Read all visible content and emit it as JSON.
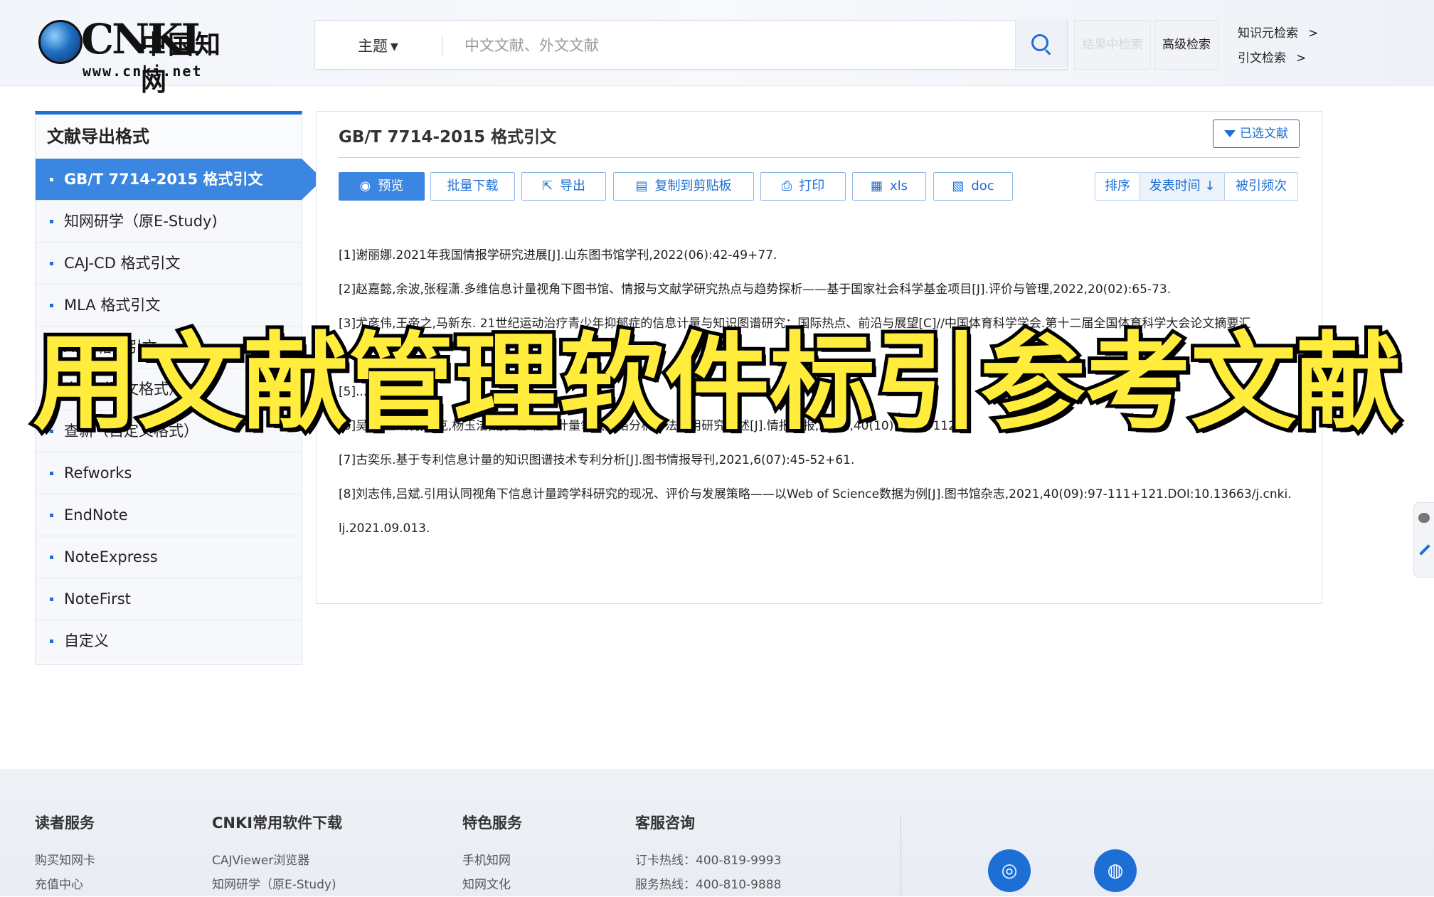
{
  "header": {
    "logo_brand": "CNKI",
    "logo_cn": "中国知网",
    "logo_url": "www.cnki.net",
    "scope_label": "主题",
    "search_placeholder": "中文文献、外文文献",
    "in_result_label": "结果中检索",
    "advanced_label": "高级检索",
    "knowledge_search": "知识元检索",
    "citation_search": "引文检索",
    "arrow": ">"
  },
  "sidebar": {
    "title": "文献导出格式",
    "items": [
      {
        "label": "GB/T 7714-2015 格式引文",
        "active": true
      },
      {
        "label": "知网研学（原E-Study)"
      },
      {
        "label": "CAJ-CD 格式引文"
      },
      {
        "label": "MLA 格式引文"
      },
      {
        "label": "APA 格式引文"
      },
      {
        "label": "查新（引文格式）"
      },
      {
        "label": "查新（自定义格式）"
      },
      {
        "label": "Refworks"
      },
      {
        "label": "EndNote"
      },
      {
        "label": "NoteExpress"
      },
      {
        "label": "NoteFirst"
      },
      {
        "label": "自定义"
      }
    ]
  },
  "panel": {
    "title": "GB/T 7714-2015 格式引文",
    "selected_label": "已选文献",
    "toolbar": {
      "preview": "预览",
      "batch_download": "批量下载",
      "export": "导出",
      "copy_clipboard": "复制到剪贴板",
      "print": "打印",
      "xls": "xls",
      "doc": "doc"
    },
    "sort": {
      "label": "排序",
      "by_date": "发表时间",
      "by_citations": "被引频次"
    },
    "references": [
      "[1]谢丽娜.2021年我国情报学研究进展[J].山东图书馆学刊,2022(06):42-49+77.",
      "[2]赵嘉懿,余波,张程潇.多维信息计量视角下图书馆、情报与文献学研究热点与趋势探析——基于国家社会科学基金项目[J].评价与管理,2022,20(02):65-73.",
      "[3]尤彦伟,王帝之,马新东. 21世纪运动治疗青少年抑郁症的信息计量与知识图谱研究：国际热点、前沿与展望[C]//中国体育科学学会.第十二届全国体育科学大会论文摘要汇",
      "",
      "[5]... 趋势[J]...",
      "[6]吴江,王凯利,董克,杨玉洁,易梦馨.信息计量领域网络分析方法应用研究综述[J].情报学报,2021,40(10):1118-1128.",
      "[7]古奕乐.基于专利信息计量的知识图谱技术专利分析[J].图书情报导刊,2021,6(07):45-52+61.",
      "[8]刘志伟,吕斌.引用认同视角下信息计量跨学科研究的现况、评价与发展策略——以Web of Science数据为例[J].图书馆杂志,2021,40(09):97-111+121.DOI:10.13663/j.cnki.",
      "lj.2021.09.013."
    ]
  },
  "overlay": {
    "title": "用文献管理软件标引参考文献"
  },
  "footer": {
    "col1": {
      "title": "读者服务",
      "links": [
        "购买知网卡",
        "充值中心"
      ]
    },
    "col2": {
      "title": "CNKI常用软件下载",
      "links": [
        "CAJViewer浏览器",
        "知网研学（原E-Study)"
      ]
    },
    "col3": {
      "title": "特色服务",
      "links": [
        "手机知网",
        "知网文化"
      ]
    },
    "col4": {
      "title": "客服咨询",
      "links": [
        "订卡热线：400-819-9993",
        "服务热线：400-810-9888"
      ]
    }
  },
  "colors": {
    "accent": "#1d6fd6",
    "active_bg": "#3b86e0",
    "overlay_text": "#ffec3d"
  }
}
